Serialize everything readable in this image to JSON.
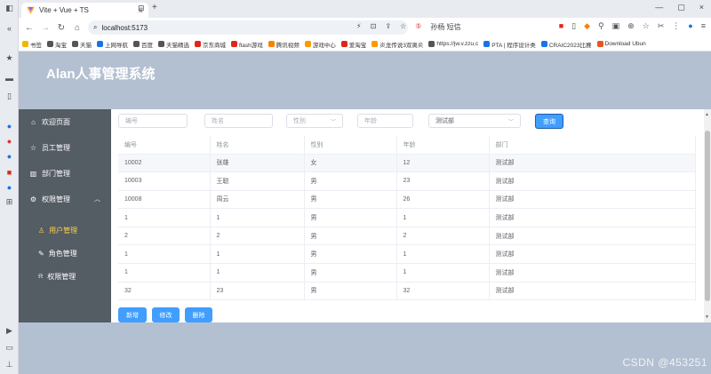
{
  "browser": {
    "tab_title": "Vite + Vue + TS",
    "tab_close": "×",
    "new_tab": "+",
    "url": "localhost:5173",
    "omni_right": [
      "孙杨 短信"
    ],
    "window_controls": [
      "—",
      "▢",
      "×"
    ],
    "bookmarks": [
      {
        "label": "书签",
        "color": "#f5b400"
      },
      {
        "label": "淘宝",
        "color": "#555555"
      },
      {
        "label": "天猫",
        "color": "#555555"
      },
      {
        "label": "上网导航",
        "color": "#1a73e8"
      },
      {
        "label": "百度",
        "color": "#555555"
      },
      {
        "label": "天猫精选",
        "color": "#555555"
      },
      {
        "label": "京东商城",
        "color": "#e1251b"
      },
      {
        "label": "flash游戏",
        "color": "#e1251b"
      },
      {
        "label": "腾讯视频",
        "color": "#ff7f00"
      },
      {
        "label": "游戏中心",
        "color": "#ff9900"
      },
      {
        "label": "爱淘宝",
        "color": "#e1251b"
      },
      {
        "label": "炎龙传说3双离炎",
        "color": "#ff9900"
      },
      {
        "label": "https://jw.v.zzu.c",
        "color": "#555555"
      },
      {
        "label": "PTA | 程序设计类",
        "color": "#1a73e8"
      },
      {
        "label": "CRAIC2023比赛",
        "color": "#1a73e8"
      },
      {
        "label": "Download Ubun",
        "color": "#e95420"
      }
    ]
  },
  "app": {
    "title": "Alan人事管理系统",
    "menu": [
      {
        "label": "欢迎页面",
        "icon": "home-icon"
      },
      {
        "label": "员工管理",
        "icon": "star-icon"
      },
      {
        "label": "部门管理",
        "icon": "building-icon"
      },
      {
        "label": "权限管理",
        "icon": "gear-icon"
      }
    ],
    "submenu": [
      {
        "label": "用户管理",
        "icon": "user-icon",
        "active": true
      },
      {
        "label": "角色管理",
        "icon": "edit-icon",
        "active": false
      },
      {
        "label": "权限管理",
        "icon": "bell-icon",
        "active": false
      }
    ],
    "search": {
      "id_placeholder": "编号",
      "name_placeholder": "姓名",
      "gender_placeholder": "性别",
      "age_placeholder": "年龄",
      "dept_value": "测试部",
      "query_label": "查询"
    },
    "table": {
      "headers": [
        "编号",
        "姓名",
        "性别",
        "年龄",
        "部门"
      ],
      "rows": [
        [
          "10002",
          "张雄",
          "女",
          "12",
          "测试部"
        ],
        [
          "10003",
          "王聪",
          "男",
          "23",
          "测试部"
        ],
        [
          "10008",
          "周云",
          "男",
          "26",
          "测试部"
        ],
        [
          "1",
          "1",
          "男",
          "1",
          "测试部"
        ],
        [
          "2",
          "2",
          "男",
          "2",
          "测试部"
        ],
        [
          "1",
          "1",
          "男",
          "1",
          "测试部"
        ],
        [
          "1",
          "1",
          "男",
          "1",
          "测试部"
        ],
        [
          "32",
          "23",
          "男",
          "32",
          "测试部"
        ]
      ]
    },
    "actions": {
      "add": "新增",
      "edit": "修改",
      "delete": "删除"
    },
    "colors": {
      "primary": "#409eff",
      "aside": "#545c64",
      "header": "#b3c0d1",
      "active_menu": "#ffd04b"
    }
  },
  "watermark": "CSDN @453251"
}
